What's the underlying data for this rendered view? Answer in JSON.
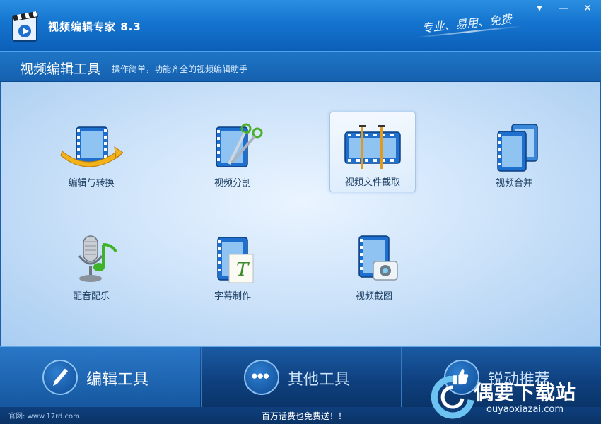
{
  "window": {
    "title": "视频编辑专家 8.3",
    "slogan": "专业、易用、免费",
    "buttons": {
      "menu": "▾",
      "minimize": "—",
      "close": "✕"
    }
  },
  "header": {
    "title": "视频编辑工具",
    "subtitle": "操作简单，功能齐全的视频编辑助手"
  },
  "tools": [
    {
      "label": "编辑与转换",
      "icon": "film-convert-icon"
    },
    {
      "label": "视频分割",
      "icon": "film-scissors-icon"
    },
    {
      "label": "视频文件截取",
      "icon": "film-clip-icon",
      "selected": true
    },
    {
      "label": "视频合并",
      "icon": "film-merge-icon"
    },
    {
      "label": "配音配乐",
      "icon": "microphone-music-icon"
    },
    {
      "label": "字幕制作",
      "icon": "film-subtitle-icon"
    },
    {
      "label": "视频截图",
      "icon": "film-camera-icon"
    }
  ],
  "nav": [
    {
      "label": "编辑工具",
      "icon": "pencil-icon",
      "active": true
    },
    {
      "label": "其他工具",
      "icon": "dots-icon"
    },
    {
      "label": "锐动推荐",
      "icon": "thumbs-up-icon"
    }
  ],
  "status": {
    "site": "官网: www.17rd.com",
    "promo": "百万话费也免费送！！"
  },
  "watermark": {
    "text": "偶要下载站",
    "url": "ouyaoxiazai.com"
  },
  "colors": {
    "titlebar": "#1474cf",
    "film_blue": "#1f6fce",
    "nav_dark": "#0e3f7d"
  }
}
